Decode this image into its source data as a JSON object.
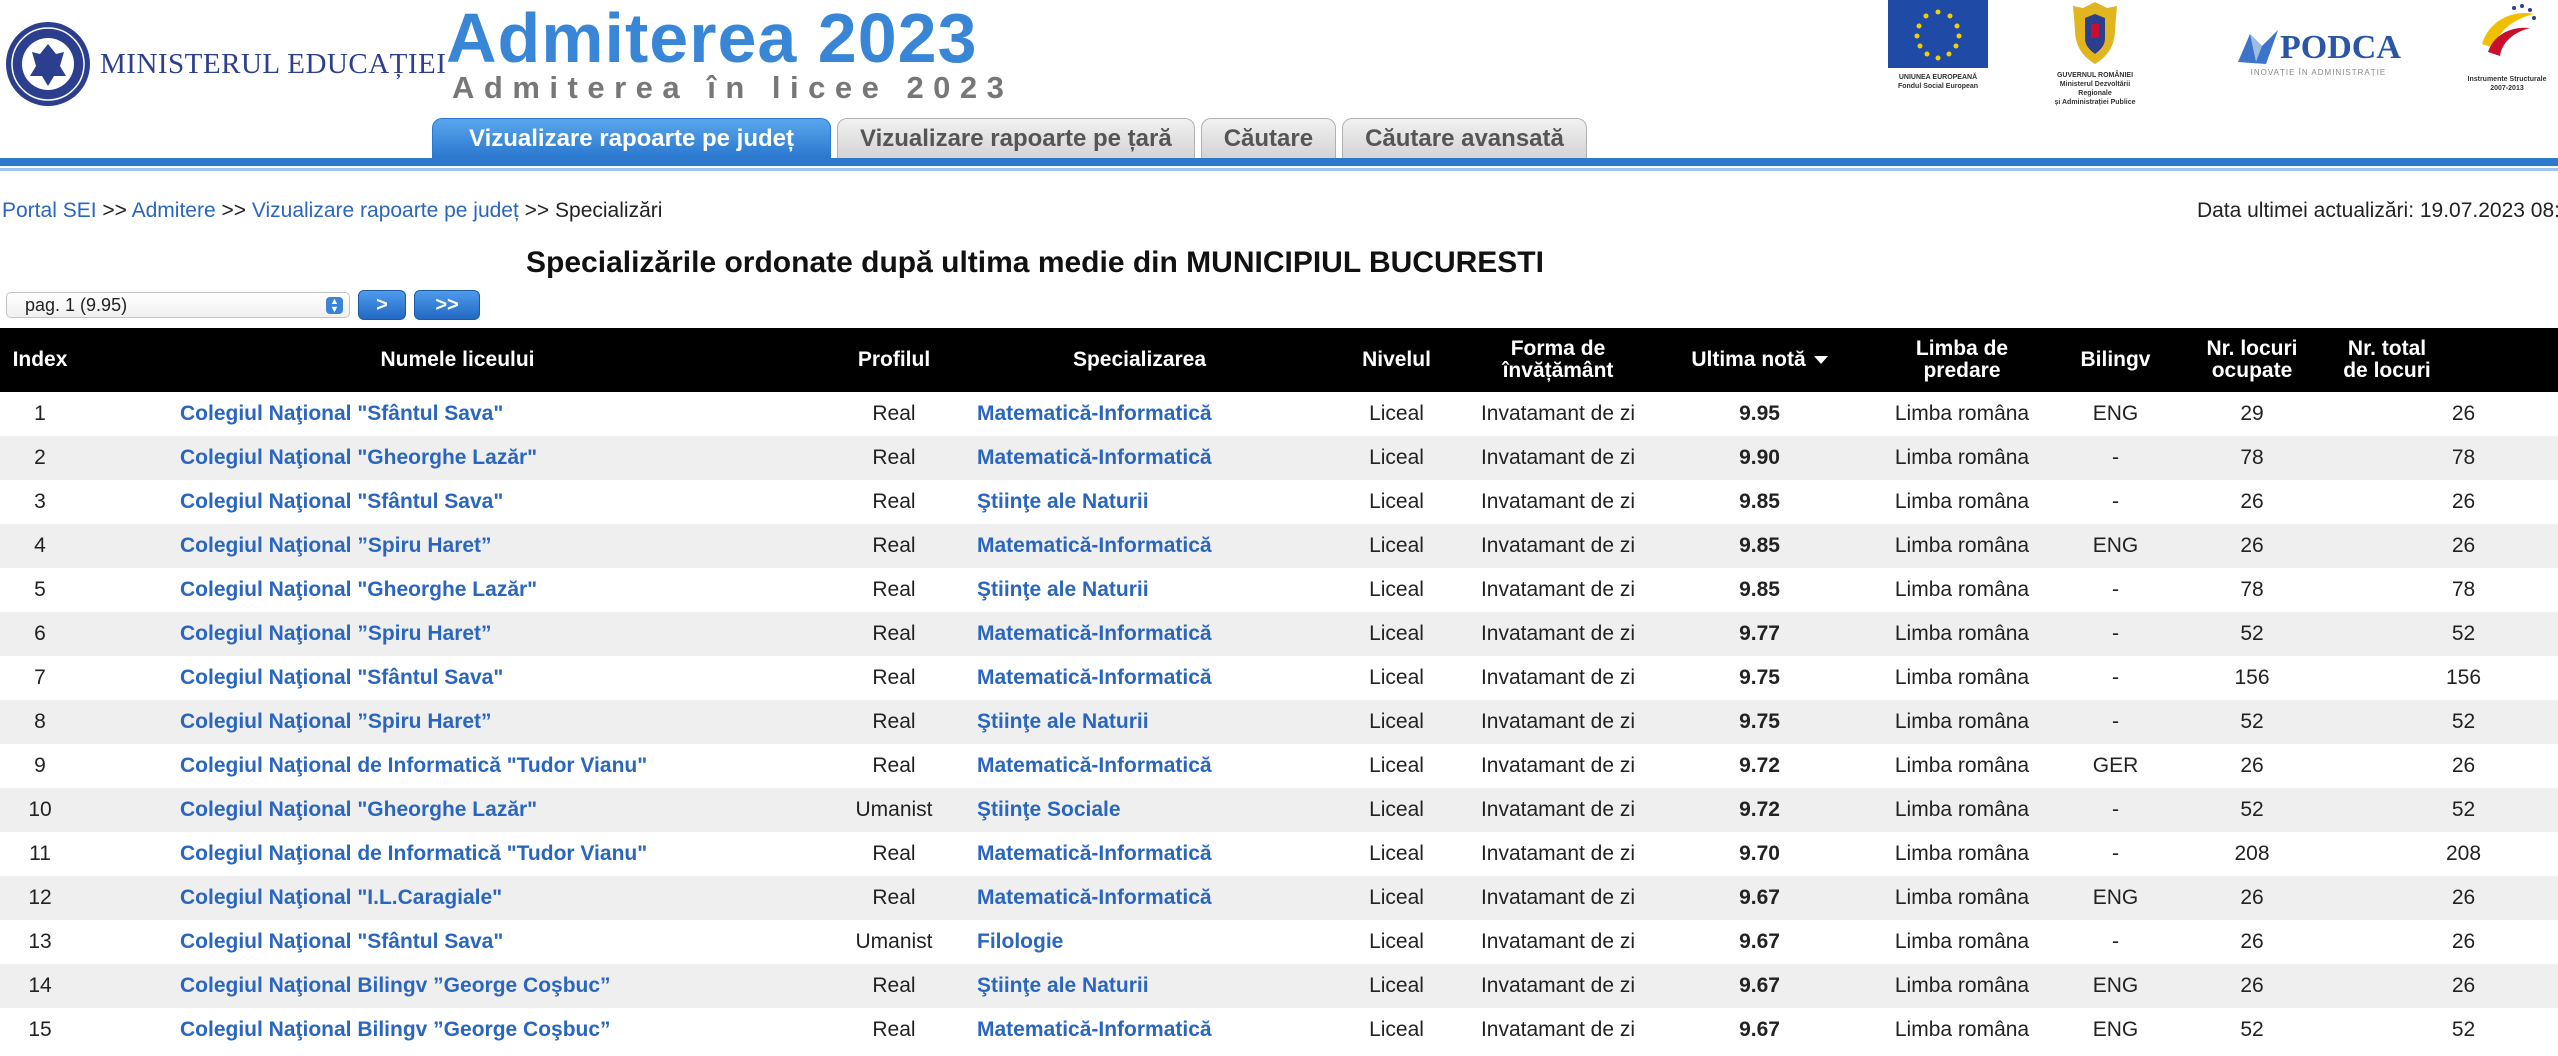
{
  "header": {
    "ministry": "MINISTERUL EDUCAȚIEI",
    "title": "Admiterea 2023",
    "subtitle": "Admiterea în licee 2023",
    "logos": {
      "eu_caption_1": "UNIUNEA EUROPEANĂ",
      "eu_caption_2": "Fondul Social European",
      "gov_caption_1": "GUVERNUL ROMÂNIEI",
      "gov_caption_2": "Ministerul Dezvoltării Regionale",
      "gov_caption_3": "și Administrației Publice",
      "podca": "PODCA",
      "podca_sub": "INOVAȚIE ÎN ADMINISTRAȚIE",
      "struct_caption_1": "Instrumente Structurale",
      "struct_caption_2": "2007-2013"
    }
  },
  "tabs": [
    {
      "label": "Vizualizare rapoarte pe județ",
      "active": true
    },
    {
      "label": "Vizualizare rapoarte pe țară",
      "active": false
    },
    {
      "label": "Căutare",
      "active": false
    },
    {
      "label": "Căutare avansată",
      "active": false
    }
  ],
  "breadcrumb": {
    "items": [
      "Portal SEI",
      "Admitere",
      "Vizualizare rapoarte pe județ"
    ],
    "separator": ">>",
    "current": "Specializări"
  },
  "updated": "Data ultimei actualizări: 19.07.2023 08:",
  "page_title": "Specializările ordonate după ultima medie din MUNICIPIUL BUCURESTI",
  "pager": {
    "select_value": "pag. 1 (9.95)",
    "next": ">",
    "last": ">>"
  },
  "colors": {
    "accent": "#2d79cc",
    "link": "#2a66bf",
    "header_bg": "#000000"
  },
  "table": {
    "headers": [
      "Index",
      "Numele liceului",
      "Profilul",
      "Specializarea",
      "Nivelul",
      "Forma de învățământ",
      "Ultima notă",
      "Limba de predare",
      "Bilingv",
      "Nr. locuri ocupate",
      "Nr. total de locuri"
    ],
    "rows": [
      [
        "1",
        "Colegiul Naţional \"Sfântul Sava\"",
        "Real",
        "Matematică-Informatică",
        "Liceal",
        "Invatamant de zi",
        "9.95",
        "Limba româna",
        "ENG",
        "29",
        "26"
      ],
      [
        "2",
        "Colegiul Naţional \"Gheorghe Lazăr\"",
        "Real",
        "Matematică-Informatică",
        "Liceal",
        "Invatamant de zi",
        "9.90",
        "Limba româna",
        "-",
        "78",
        "78"
      ],
      [
        "3",
        "Colegiul Naţional \"Sfântul Sava\"",
        "Real",
        "Ştiinţe ale Naturii",
        "Liceal",
        "Invatamant de zi",
        "9.85",
        "Limba româna",
        "-",
        "26",
        "26"
      ],
      [
        "4",
        "Colegiul Naţional ”Spiru Haret”",
        "Real",
        "Matematică-Informatică",
        "Liceal",
        "Invatamant de zi",
        "9.85",
        "Limba româna",
        "ENG",
        "26",
        "26"
      ],
      [
        "5",
        "Colegiul Naţional \"Gheorghe Lazăr\"",
        "Real",
        "Ştiinţe ale Naturii",
        "Liceal",
        "Invatamant de zi",
        "9.85",
        "Limba româna",
        "-",
        "78",
        "78"
      ],
      [
        "6",
        "Colegiul Naţional ”Spiru Haret”",
        "Real",
        "Matematică-Informatică",
        "Liceal",
        "Invatamant de zi",
        "9.77",
        "Limba româna",
        "-",
        "52",
        "52"
      ],
      [
        "7",
        "Colegiul Naţional \"Sfântul Sava\"",
        "Real",
        "Matematică-Informatică",
        "Liceal",
        "Invatamant de zi",
        "9.75",
        "Limba româna",
        "-",
        "156",
        "156"
      ],
      [
        "8",
        "Colegiul Naţional ”Spiru Haret”",
        "Real",
        "Ştiinţe ale Naturii",
        "Liceal",
        "Invatamant de zi",
        "9.75",
        "Limba româna",
        "-",
        "52",
        "52"
      ],
      [
        "9",
        "Colegiul Naţional de Informatică \"Tudor Vianu\"",
        "Real",
        "Matematică-Informatică",
        "Liceal",
        "Invatamant de zi",
        "9.72",
        "Limba româna",
        "GER",
        "26",
        "26"
      ],
      [
        "10",
        "Colegiul Naţional \"Gheorghe Lazăr\"",
        "Umanist",
        "Ştiinţe Sociale",
        "Liceal",
        "Invatamant de zi",
        "9.72",
        "Limba româna",
        "-",
        "52",
        "52"
      ],
      [
        "11",
        "Colegiul Naţional de Informatică \"Tudor Vianu\"",
        "Real",
        "Matematică-Informatică",
        "Liceal",
        "Invatamant de zi",
        "9.70",
        "Limba româna",
        "-",
        "208",
        "208"
      ],
      [
        "12",
        "Colegiul Naţional \"I.L.Caragiale\"",
        "Real",
        "Matematică-Informatică",
        "Liceal",
        "Invatamant de zi",
        "9.67",
        "Limba româna",
        "ENG",
        "26",
        "26"
      ],
      [
        "13",
        "Colegiul Naţional \"Sfântul Sava\"",
        "Umanist",
        "Filologie",
        "Liceal",
        "Invatamant de zi",
        "9.67",
        "Limba româna",
        "-",
        "26",
        "26"
      ],
      [
        "14",
        "Colegiul Naţional Bilingv ”George Coşbuc”",
        "Real",
        "Ştiinţe ale Naturii",
        "Liceal",
        "Invatamant de zi",
        "9.67",
        "Limba româna",
        "ENG",
        "26",
        "26"
      ],
      [
        "15",
        "Colegiul Naţional Bilingv ”George Coşbuc”",
        "Real",
        "Matematică-Informatică",
        "Liceal",
        "Invatamant de zi",
        "9.67",
        "Limba româna",
        "ENG",
        "52",
        "52"
      ]
    ]
  }
}
